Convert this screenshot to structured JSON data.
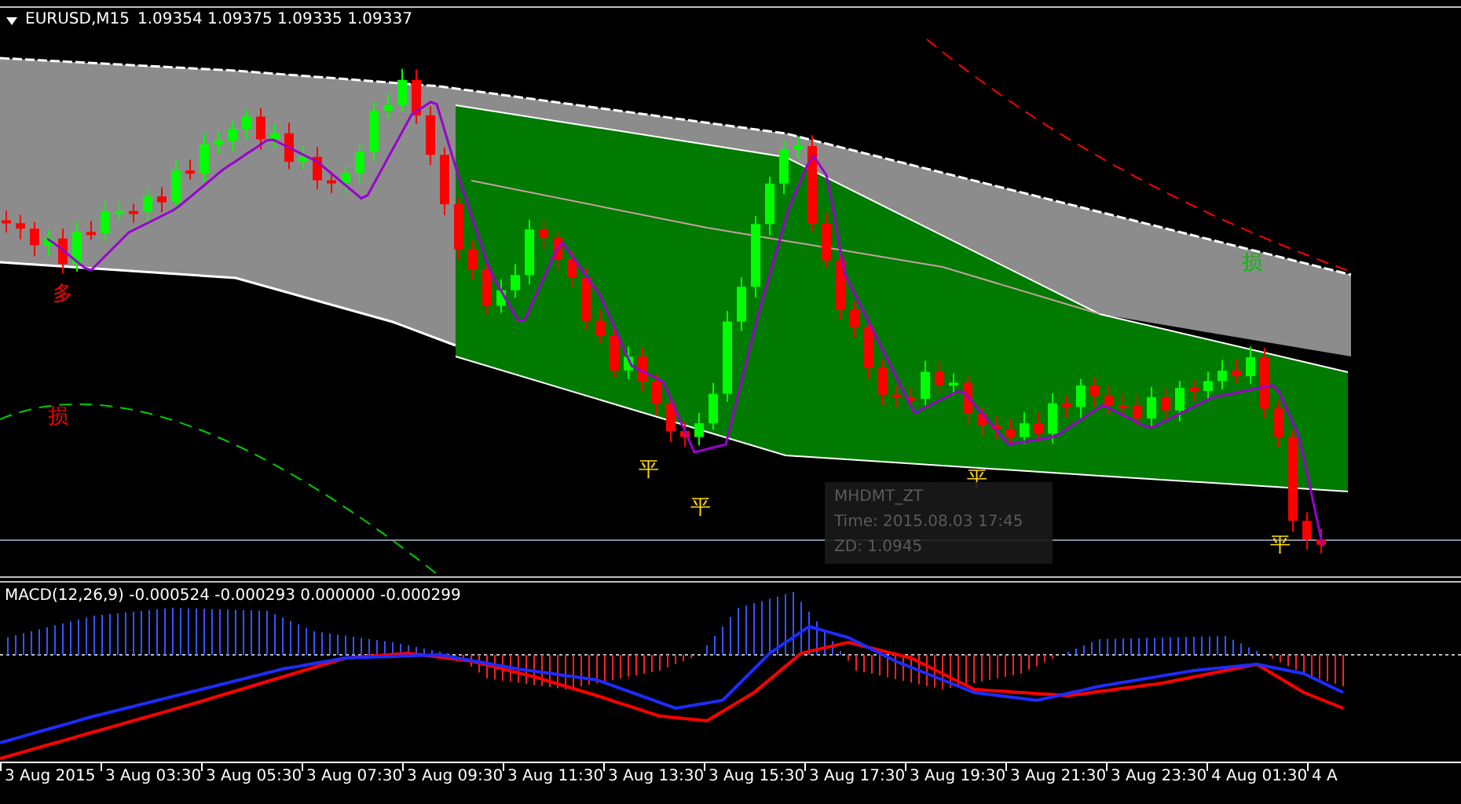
{
  "chart": {
    "symbol": "EURUSD,M15",
    "quote": "1.09354 1.09375 1.09335 1.09337",
    "markers": [
      {
        "text": "多",
        "color": "#ff0000"
      },
      {
        "text": "损",
        "color": "#ff0000"
      },
      {
        "text": "平",
        "color": "#ffd800"
      },
      {
        "text": "平",
        "color": "#ffd800"
      },
      {
        "text": "平",
        "color": "#ffd800"
      },
      {
        "text": "损",
        "color": "#00c000"
      },
      {
        "text": "平",
        "color": "#ffd800"
      }
    ],
    "tooltip": {
      "title": "MHDMT_ZT",
      "time": "Time: 2015.08.03 17:45",
      "value": "ZD: 1.0945"
    }
  },
  "indicator": {
    "label": "MACD(12,26,9) -0.000524 -0.000293 0.000000 -0.000299"
  },
  "time_axis": {
    "labels": [
      "3 Aug 2015",
      "3 Aug 03:30",
      "3 Aug 05:30",
      "3 Aug 07:30",
      "3 Aug 09:30",
      "3 Aug 11:30",
      "3 Aug 13:30",
      "3 Aug 15:30",
      "3 Aug 17:30",
      "3 Aug 19:30",
      "3 Aug 21:30",
      "3 Aug 23:30",
      "4 Aug 01:30",
      "4 A"
    ]
  }
}
